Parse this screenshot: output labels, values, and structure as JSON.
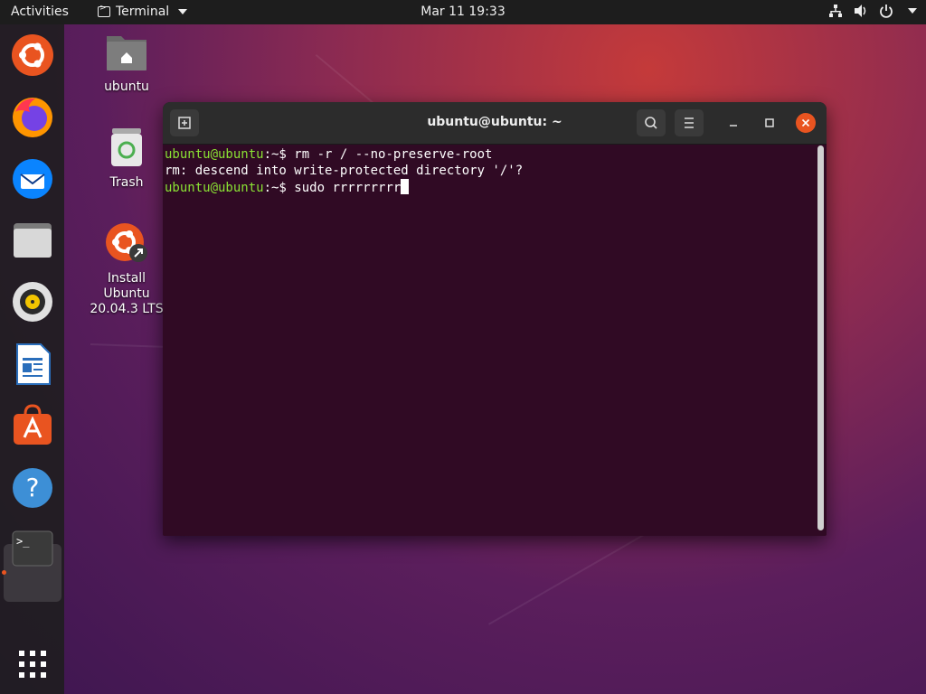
{
  "topbar": {
    "activities": "Activities",
    "app_name": "Terminal",
    "clock": "Mar 11  19:33",
    "tray_icons": [
      "network-icon",
      "volume-icon",
      "power-icon",
      "system-menu-caret-icon"
    ]
  },
  "dock": {
    "items": [
      {
        "name": "ubuntu-icon"
      },
      {
        "name": "firefox-icon"
      },
      {
        "name": "thunderbird-icon"
      },
      {
        "name": "files-icon"
      },
      {
        "name": "rhythmbox-icon"
      },
      {
        "name": "libreoffice-writer-icon"
      },
      {
        "name": "ubuntu-software-icon"
      },
      {
        "name": "help-icon"
      },
      {
        "name": "terminal-icon",
        "active": true
      }
    ],
    "show_apps": "show-applications-icon"
  },
  "desktop": {
    "icons": [
      {
        "label": "ubuntu"
      },
      {
        "label": "Trash"
      },
      {
        "label": "Install Ubuntu 20.04.3 LTS"
      }
    ]
  },
  "terminal": {
    "title": "ubuntu@ubuntu: ~",
    "lines": [
      {
        "prompt": "ubuntu@ubuntu",
        "suffix": ":~$ ",
        "command": "rm -r / --no-preserve-root"
      },
      {
        "output": "rm: descend into write-protected directory '/'?"
      },
      {
        "prompt": "ubuntu@ubuntu",
        "suffix": ":~$ ",
        "command": "sudo rrrrrrrrr"
      }
    ]
  },
  "colors": {
    "accent": "#e95420",
    "terminal_bg": "#300a24",
    "prompt_green": "#8ae234",
    "topbar_bg": "#1d1d1d"
  }
}
